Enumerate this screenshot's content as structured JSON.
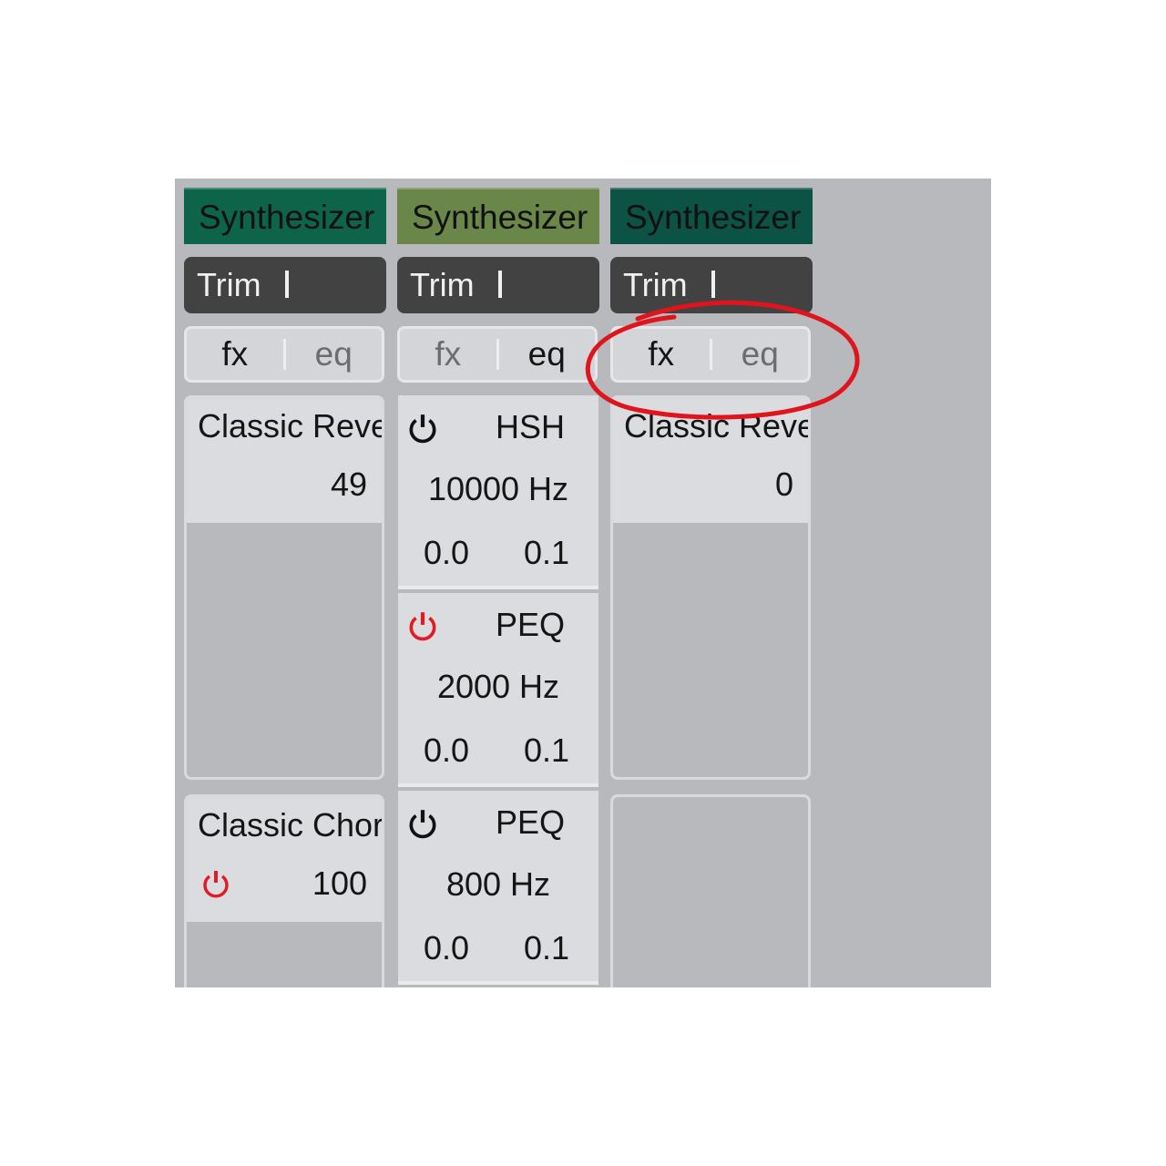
{
  "strips": [
    {
      "name": "Synthesizer",
      "name_color": "#0e6448",
      "trim_label": "Trim",
      "tabs": {
        "fx": "fx",
        "eq": "eq",
        "active": "fx"
      },
      "fx_slots": [
        {
          "name": "Classic Reverb",
          "value": "49",
          "power": null
        },
        {
          "name": "Classic Chorus",
          "value": "100",
          "power": "red"
        }
      ]
    },
    {
      "name": "Synthesizer",
      "name_color": "#6b8649",
      "trim_label": "Trim",
      "tabs": {
        "fx": "fx",
        "eq": "eq",
        "active": "eq"
      },
      "eq_bands": [
        {
          "type": "HSH",
          "freq": "10000 Hz",
          "gain": "0.0",
          "q": "0.1",
          "power": "black"
        },
        {
          "type": "PEQ",
          "freq": "2000 Hz",
          "gain": "0.0",
          "q": "0.1",
          "power": "red"
        },
        {
          "type": "PEQ",
          "freq": "800 Hz",
          "gain": "0.0",
          "q": "0.1",
          "power": "black"
        }
      ]
    },
    {
      "name": "Synthesizer",
      "name_color": "#0c5245",
      "trim_label": "Trim",
      "tabs": {
        "fx": "fx",
        "eq": "eq",
        "active": "fx"
      },
      "fx_slots": [
        {
          "name": "Classic Reverb",
          "value": "0",
          "power": null
        }
      ]
    }
  ],
  "colors": {
    "panel_bg": "#b7b9bd",
    "power_on": "#e21c24",
    "power_off": "#111111",
    "annotation_circle": "#e0141c"
  }
}
